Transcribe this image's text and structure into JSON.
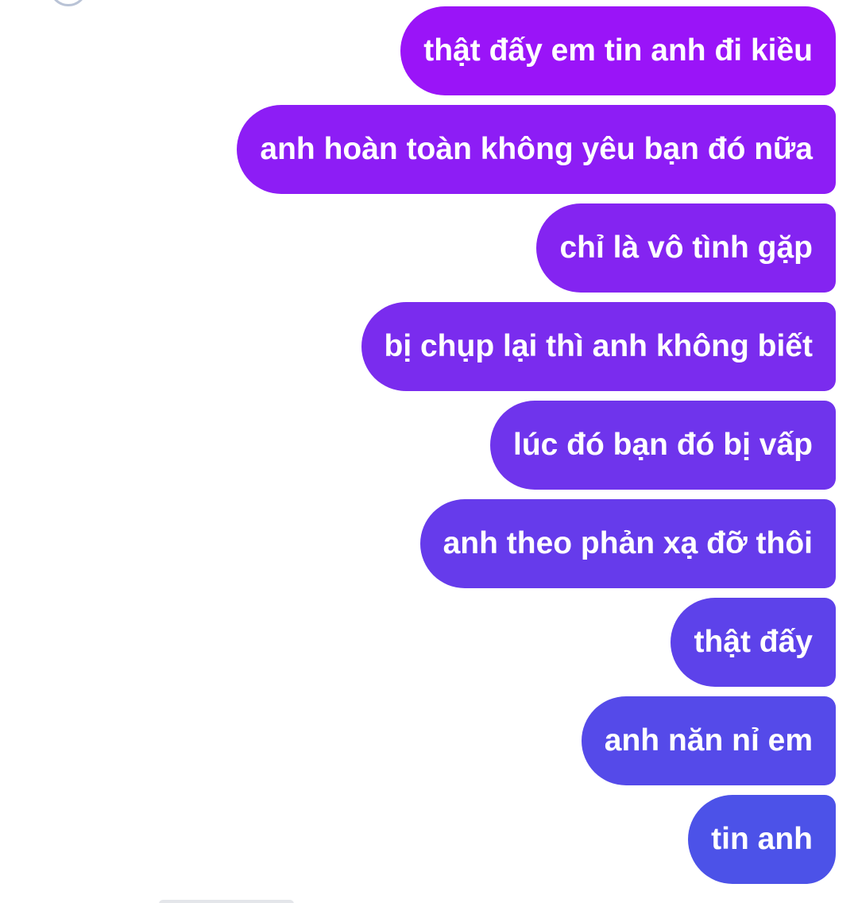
{
  "thread": {
    "messages": [
      {
        "text": "thật đấy em tin anh đi kiều",
        "color": "#9a14f8"
      },
      {
        "text": "anh hoàn toàn không yêu bạn đó nữa ",
        "color": "#8d1df5"
      },
      {
        "text": "chỉ là vô tình gặp ",
        "color": "#8424f1"
      },
      {
        "text": "bị chụp lại thì anh không biết",
        "color": "#7a2cee"
      },
      {
        "text": "lúc đó bạn đó bị vấp",
        "color": "#6f34ec"
      },
      {
        "text": "anh theo phản xạ đỡ thôi",
        "color": "#663beb"
      },
      {
        "text": "thật đấy",
        "color": "#5d42ea"
      },
      {
        "text": "anh năn nỉ em",
        "color": "#554ae9"
      },
      {
        "text": "tin anh",
        "color": "#4c52e8"
      }
    ]
  }
}
